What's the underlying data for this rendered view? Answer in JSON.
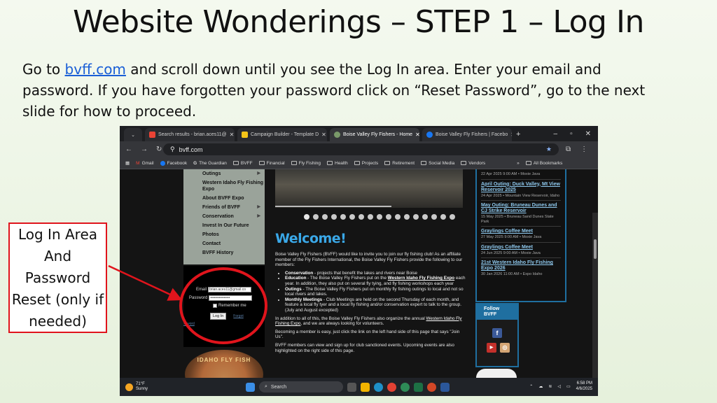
{
  "slide": {
    "title": "Website Wonderings – STEP 1 – Log In",
    "body_prefix": "Go to ",
    "body_link": "bvff.com",
    "body_suffix": " and scroll down until you see the Log In area. Enter your email and password. If you have forgotten your password click on “Reset Password”, go to the next slide for how to proceed.",
    "callout": "Log In Area And Password Reset (only if needed)",
    "colors": {
      "callout_border": "#e0141c",
      "link": "#1a5fd6"
    }
  },
  "browser": {
    "tabs": [
      {
        "label": "Search results - brian.aces11@",
        "icon": "gmail-icon"
      },
      {
        "label": "Campaign Builder - Template D",
        "icon": "campaign-icon"
      },
      {
        "label": "Boise Valley Fly Fishers - Home",
        "icon": "bvff-icon",
        "active": true
      },
      {
        "label": "Boise Valley Fly Fishers | Facebo",
        "icon": "facebook-icon"
      }
    ],
    "new_tab": "+",
    "window_controls": [
      "–",
      "▫",
      "✕"
    ],
    "url": "bvff.com",
    "bookmarks": [
      "Gmail",
      "Facebook",
      "The Guardian",
      "BVFF",
      "Financial",
      "Fly Fishing",
      "Health",
      "Projects",
      "Retirement",
      "Social Media",
      "Vendors"
    ],
    "bookmarks_overflow": "»",
    "all_bookmarks": "All Bookmarks"
  },
  "site": {
    "menu": [
      {
        "label": "Outings",
        "caret": true
      },
      {
        "label": "Western Idaho Fly Fishing Expo",
        "caret": false
      },
      {
        "label": "About BVFF Expo",
        "caret": false
      },
      {
        "label": "Friends of BVFF",
        "caret": true
      },
      {
        "label": "Conservation",
        "caret": true
      },
      {
        "label": "Invest In Our Future",
        "caret": false
      },
      {
        "label": "Photos",
        "caret": false
      },
      {
        "label": "Contact",
        "caret": false
      },
      {
        "label": "BVFF History",
        "caret": false
      }
    ],
    "login": {
      "email_label": "Email",
      "email_value": "brian.aces11@gmail.co",
      "password_label": "Password",
      "password_value": "••••••••••••••••",
      "remember": "Remember me",
      "button": "Log In",
      "forgot": "Forgot",
      "reset": "ssword"
    },
    "emblem_text": "IDAHO FLY FISH",
    "welcome": "Welcome!",
    "intro": "Boise Valley Fly Fishers (BVFF) would like to invite you to join our fly fishing club! As an affiliate member of the Fly Fishers International, the Boise Valley Fly Fishers provide the following to our members:",
    "bullets": [
      {
        "bold": "Conservation",
        "text": " - projects that benefit the lakes and rivers near Boise"
      },
      {
        "bold": "Education",
        "text": " - The Boise Valley Fly Fishers put on the ",
        "link": "Western Idaho Fly Fishing Expo",
        "after": " each year. In addition, they also put on several fly tying, and fly fishing workshops each year"
      },
      {
        "bold": "Outings",
        "text": " - The Boise Valley Fly Fishers put on monthly fly fishing outings to local and not so local rivers and lakes."
      },
      {
        "bold": "Monthly Meetings",
        "text": " - Club Meetings are held on the second Thursday of each month, and feature a local fly tyer and a local fly fishing and/or conservation expert to talk to the group. (July and August excepted)"
      }
    ],
    "para2_prefix": "In addition to all of this, the Boise Valley Fly Fishers also organize the annual ",
    "para2_link": "Western Idaho Fly Fishing Expo",
    "para2_suffix": ", and we are always looking for volunteers.",
    "para3": "Becoming a member is easy, just click the link on the left hand side of this page that says \"Join Us\".",
    "para4": "BVFF members can view and sign up for club sanctioned events. Upcoming events are also highlighted on the right side of this page.",
    "events": [
      {
        "title": "",
        "detail": "22 Apr 2025 9:00 AM • Moxie Java"
      },
      {
        "title": "April Outing: Duck Valley, Mt View Reservoir 2025",
        "detail": "24 Apr 2025 • Mountain View Reservoir, Idaho"
      },
      {
        "title": "May Outing: Bruneau Dunes and CJ Strike Reservoir",
        "detail": "15 May 2025 • Bruneau Sand Dunes State Park"
      },
      {
        "title": "Graylings Coffee Meet",
        "detail": "27 May 2025 9:00 AM • Moxie Java"
      },
      {
        "title": "Graylings Coffee Meet",
        "detail": "24 Jun 2025 9:00 AM • Moxie Java"
      },
      {
        "title": "21st Western Idaho Fly Fishing Expo 2026",
        "detail": "30 Jan 2026 11:00 AM • Expo Idaho"
      }
    ],
    "follow": "Follow BVFF"
  },
  "taskbar": {
    "temp": "71°F",
    "weather": "Sunny",
    "search": "Search",
    "time": "6:58 PM",
    "date": "4/6/2025"
  }
}
